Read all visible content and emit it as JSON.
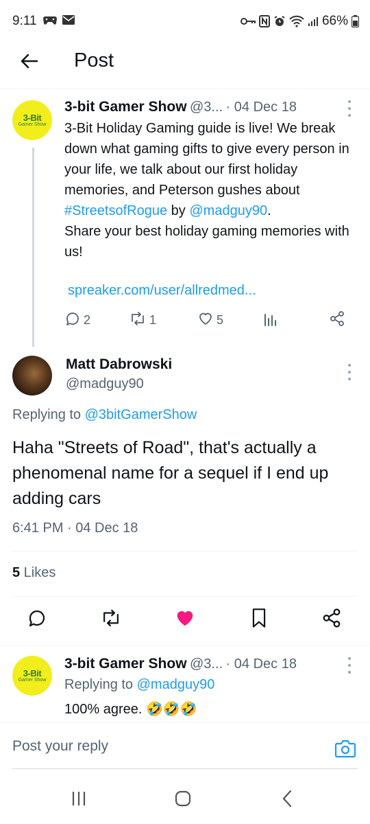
{
  "status_bar": {
    "time": "9:11",
    "battery": "66%",
    "left_icons": [
      "gamepad-icon",
      "mail-icon"
    ],
    "right_icons": [
      "key-icon",
      "nfc-icon",
      "alarm-icon",
      "wifi-icon",
      "signal-icon",
      "battery-icon"
    ]
  },
  "header": {
    "title": "Post"
  },
  "parent_tweet": {
    "name": "3-bit Gamer Show",
    "handle": "@3...",
    "date": "· 04 Dec 18",
    "avatar_text_1": "3-Bit",
    "avatar_text_2": "Gamer Show",
    "body_1": "3-Bit Holiday Gaming guide is live! We break down what gaming gifts to give every person in your life, we talk about our first holiday memories, and Peterson gushes about ",
    "hashtag": "#StreetsofRogue",
    "body_2": " by ",
    "mention": "@madguy90",
    "body_3": ".",
    "body_4": "Share your best holiday gaming memories with us!",
    "link": "spreaker.com/user/allredmed...",
    "replies": "2",
    "reposts": "1",
    "likes": "5"
  },
  "main_tweet": {
    "name": "Matt Dabrowski",
    "handle": "@madguy90",
    "replying_prefix": "Replying to ",
    "replying_to": "@3bitGamerShow",
    "body": "Haha \"Streets of Road\", that's actually a phenomenal name for a sequel if I end up adding cars",
    "timestamp": "6:41 PM · 04 Dec 18",
    "likes_count": "5",
    "likes_label": " Likes",
    "liked": true,
    "accent": "#f91880"
  },
  "reply_tweet": {
    "name": "3-bit Gamer Show",
    "handle": "@3...",
    "date": "· 04 Dec 18",
    "replying_prefix": "Replying to ",
    "replying_to": "@madguy90",
    "body": "100% agree. 🤣🤣🤣"
  },
  "composer": {
    "placeholder": "Post your reply"
  },
  "colors": {
    "link": "#1d9bf0",
    "secondary": "#536471",
    "like": "#f91880"
  }
}
